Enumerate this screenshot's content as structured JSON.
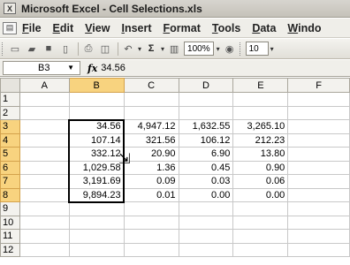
{
  "window": {
    "title": "Microsoft Excel - Cell Selections.xls",
    "app_icon_glyph": "X"
  },
  "menu": [
    "File",
    "Edit",
    "View",
    "Insert",
    "Format",
    "Tools",
    "Data",
    "Windo"
  ],
  "toolbar": {
    "zoom": "100%",
    "font_size": "10"
  },
  "formula_bar": {
    "name_box": "B3",
    "fx_label": "fx",
    "formula": "34.56"
  },
  "columns": [
    "A",
    "B",
    "C",
    "D",
    "E",
    "F"
  ],
  "rows": [
    {
      "num": "1",
      "cells": [
        "",
        "",
        "",
        "",
        "",
        ""
      ]
    },
    {
      "num": "2",
      "cells": [
        "",
        "",
        "",
        "",
        "",
        ""
      ]
    },
    {
      "num": "3",
      "cells": [
        "",
        "34.56",
        "4,947.12",
        "1,632.55",
        "3,265.10",
        ""
      ]
    },
    {
      "num": "4",
      "cells": [
        "",
        "107.14",
        "321.56",
        "106.12",
        "212.23",
        ""
      ]
    },
    {
      "num": "5",
      "cells": [
        "",
        "332.12",
        "20.90",
        "6.90",
        "13.80",
        ""
      ]
    },
    {
      "num": "6",
      "cells": [
        "",
        "1,029.58",
        "1.36",
        "0.45",
        "0.90",
        ""
      ]
    },
    {
      "num": "7",
      "cells": [
        "",
        "3,191.69",
        "0.09",
        "0.03",
        "0.06",
        ""
      ]
    },
    {
      "num": "8",
      "cells": [
        "",
        "9,894.23",
        "0.01",
        "0.00",
        "0.00",
        ""
      ]
    },
    {
      "num": "9",
      "cells": [
        "",
        "",
        "",
        "",
        "",
        ""
      ]
    },
    {
      "num": "10",
      "cells": [
        "",
        "",
        "",
        "",
        "",
        ""
      ]
    },
    {
      "num": "11",
      "cells": [
        "",
        "",
        "",
        "",
        "",
        ""
      ]
    },
    {
      "num": "12",
      "cells": [
        "",
        "",
        "",
        "",
        "",
        ""
      ]
    }
  ]
}
